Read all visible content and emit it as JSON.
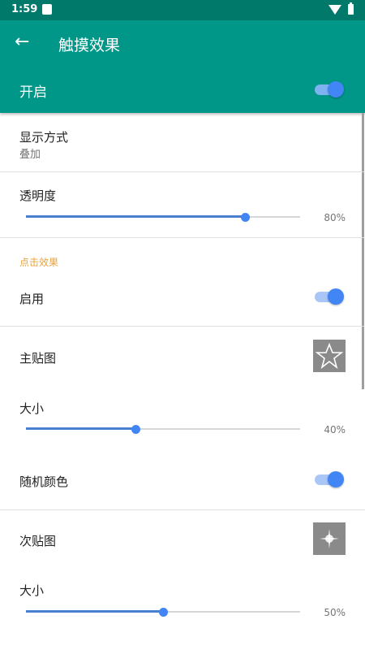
{
  "status": {
    "time": "1:59"
  },
  "app_bar": {
    "title": "触摸效果"
  },
  "master": {
    "label": "开启",
    "enabled": true
  },
  "display_mode": {
    "title": "显示方式",
    "value": "叠加"
  },
  "opacity": {
    "title": "透明度",
    "value": 80,
    "value_text": "80%"
  },
  "click_section": {
    "title": "点击效果",
    "enable": {
      "label": "启用",
      "enabled": true
    },
    "main_image": {
      "label": "主贴图",
      "icon": "star-icon"
    },
    "main_size": {
      "label": "大小",
      "value": 40,
      "value_text": "40%"
    },
    "random_color": {
      "label": "随机颜色",
      "enabled": true
    },
    "sub_image": {
      "label": "次贴图",
      "icon": "sparkle-icon"
    },
    "sub_size": {
      "label": "大小",
      "value": 50,
      "value_text": "50%"
    }
  },
  "colors": {
    "primary": "#009688",
    "primary_dark": "#00796b",
    "accent": "#4285f4",
    "section": "#e8a33c"
  }
}
